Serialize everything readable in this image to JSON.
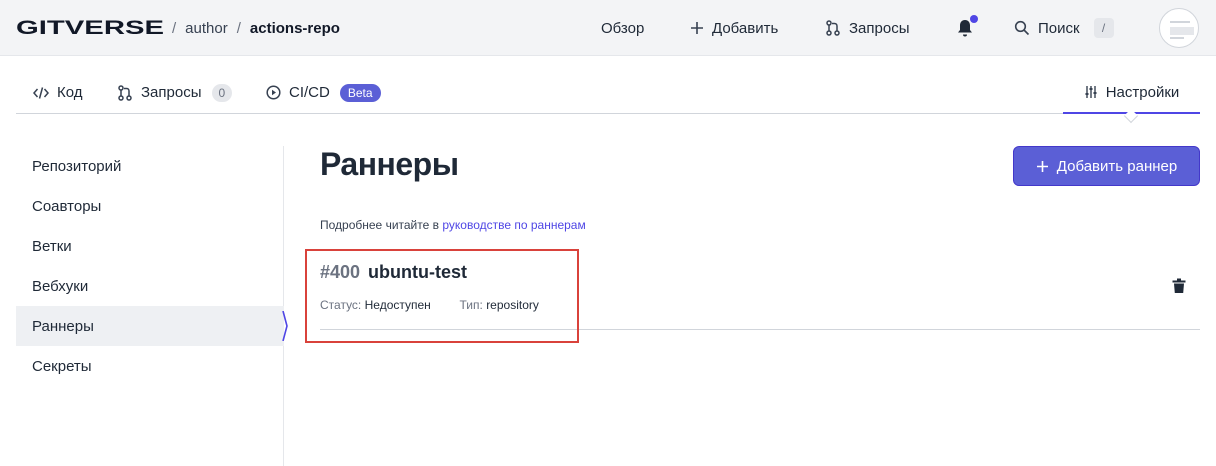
{
  "header": {
    "logo_text": "GITVERSE",
    "breadcrumb": {
      "owner": "author",
      "separator": "/",
      "repo": "actions-repo"
    },
    "nav": {
      "overview": "Обзор",
      "add": "Добавить",
      "requests": "Запросы",
      "search": "Поиск",
      "search_shortcut": "/"
    }
  },
  "tabs": {
    "code": "Код",
    "requests": "Запросы",
    "requests_count": "0",
    "cicd": "CI/CD",
    "cicd_badge": "Beta",
    "settings": "Настройки"
  },
  "sidebar": {
    "items": [
      {
        "label": "Репозиторий"
      },
      {
        "label": "Соавторы"
      },
      {
        "label": "Ветки"
      },
      {
        "label": "Вебхуки"
      },
      {
        "label": "Раннеры",
        "active": true
      },
      {
        "label": "Секреты"
      }
    ]
  },
  "main": {
    "title": "Раннеры",
    "add_button": "Добавить раннер",
    "help_prefix": "Подробнее читайте в",
    "help_link": "руководстве по раннерам",
    "runner": {
      "id": "#400",
      "name": "ubuntu-test",
      "status_key": "Статус:",
      "status_value": "Недоступен",
      "type_key": "Тип:",
      "type_value": "repository"
    }
  },
  "colors": {
    "accent": "#5b5fd6",
    "highlight": "#d9423b",
    "notification": "#4f46e5"
  }
}
